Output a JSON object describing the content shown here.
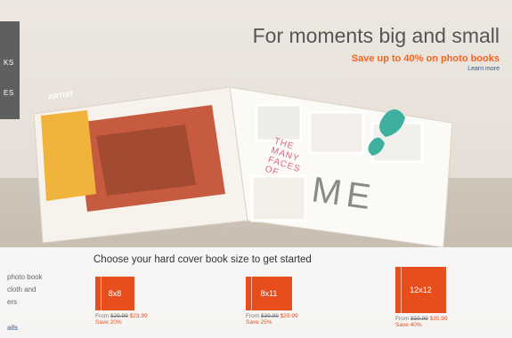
{
  "sidebar": {
    "items": [
      "KS",
      "ES"
    ]
  },
  "header": {
    "title": "For moments big and small",
    "promo": "Save up to 40% on photo books",
    "link": "Learn more"
  },
  "book": {
    "page_title": [
      "THE",
      "MANY",
      "FACES",
      "OF"
    ],
    "page_big": "ME",
    "left_page_text": "ARTIST"
  },
  "chooser": {
    "prompt": "Choose your hard cover book size to get started",
    "left_lines": [
      "photo book",
      "cloth and",
      "ers"
    ],
    "left_link": "ails",
    "options": [
      {
        "size": "8x8",
        "from": "From",
        "orig": "$29.99",
        "sale": "$23.99",
        "save": "Save 20%"
      },
      {
        "size": "8x11",
        "from": "From",
        "orig": "$39.99",
        "sale": "$29.99",
        "save": "Save 25%"
      },
      {
        "size": "12x12",
        "from": "From",
        "orig": "$59.99",
        "sale": "$35.99",
        "save": "Save 40%"
      }
    ]
  },
  "colors": {
    "accent": "#e84e1b",
    "promo": "#f26522",
    "link": "#2b5f9e"
  }
}
